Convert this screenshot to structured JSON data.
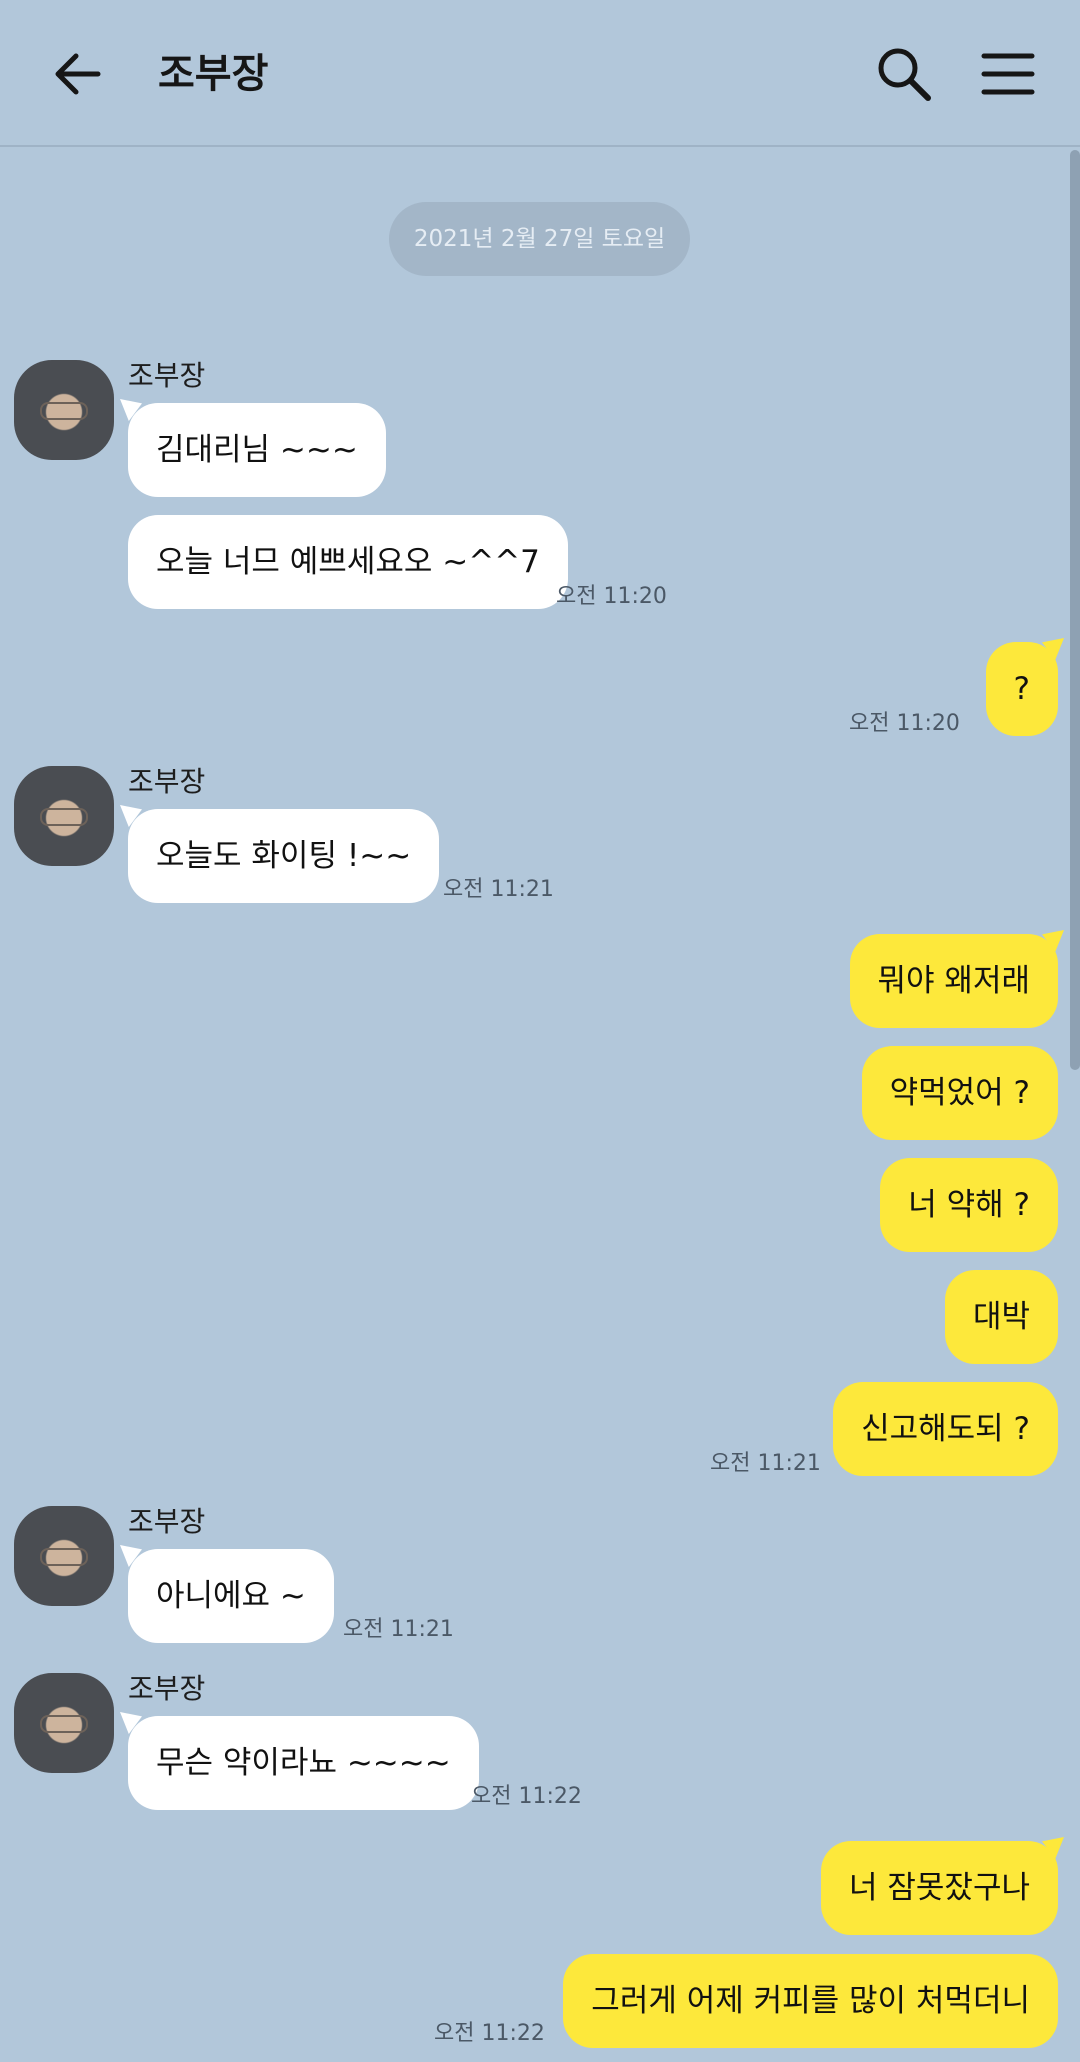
{
  "header": {
    "title": "조부장"
  },
  "date_divider": "2021년 2월 27일 토요일",
  "messages": [
    {
      "sender": "조부장",
      "text": "김대리님 ~~~"
    },
    {
      "text": "오늘 너므 예쁘세요오 ~^^7",
      "time": "오전 11:20"
    },
    {
      "text": "?",
      "time": "오전 11:20"
    },
    {
      "sender": "조부장",
      "text": "오늘도 화이팅 !~~",
      "time": "오전 11:21"
    },
    {
      "text": "뭐야 왜저래"
    },
    {
      "text": "약먹었어 ?"
    },
    {
      "text": "너 약해 ?"
    },
    {
      "text": "대박"
    },
    {
      "text": "신고해도되 ?",
      "time": "오전 11:21"
    },
    {
      "sender": "조부장",
      "text": "아니에요 ~",
      "time": "오전 11:21"
    },
    {
      "sender": "조부장",
      "text": "무슨 약이라뇨 ~~~~",
      "time": "오전 11:22"
    },
    {
      "text": "너 잠못잤구나"
    },
    {
      "text": "그러게 어제 커피를 많이 처먹더니",
      "time": "오전 11:22"
    }
  ],
  "colors": {
    "background": "#b2c7da",
    "outgoing_bubble": "#fde83b",
    "incoming_bubble": "#ffffff"
  },
  "icons": {
    "back": "arrow-left-icon",
    "search": "search-icon",
    "menu": "hamburger-menu-icon"
  }
}
